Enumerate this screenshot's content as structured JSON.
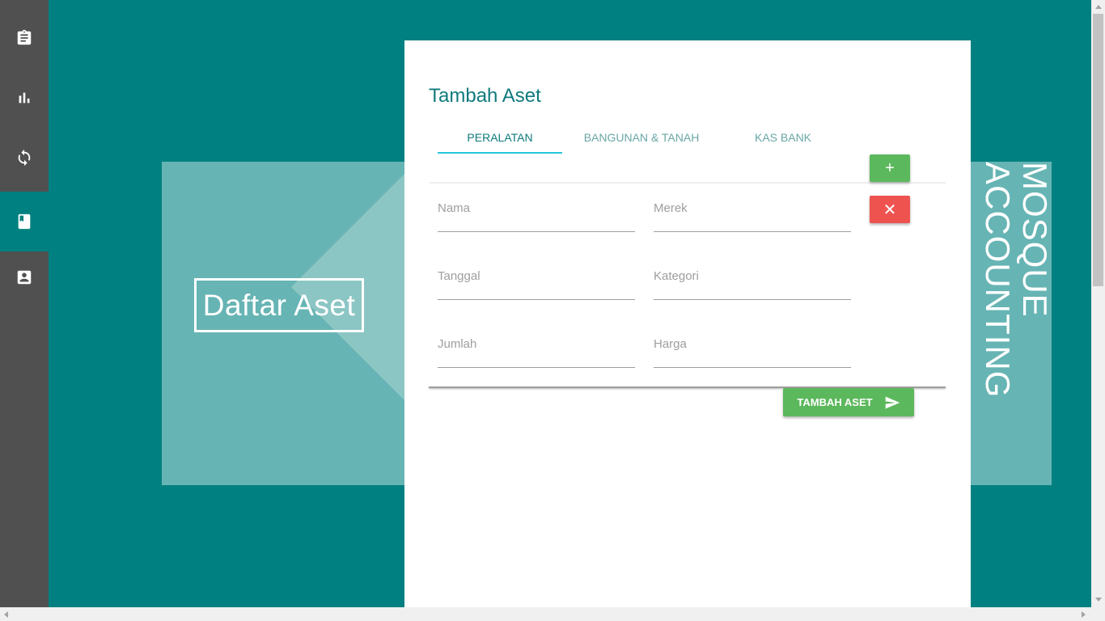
{
  "sidebar": {
    "items": [
      {
        "icon": "clipboard-icon",
        "active": false
      },
      {
        "icon": "bar-chart-icon",
        "active": false
      },
      {
        "icon": "sync-icon",
        "active": false
      },
      {
        "icon": "book-icon",
        "active": true
      },
      {
        "icon": "contact-icon",
        "active": false
      }
    ]
  },
  "hero": {
    "title": "Daftar Aset"
  },
  "brand": {
    "line1": "MOSQUE",
    "line2": "ACCOUNTING"
  },
  "card": {
    "title": "Tambah Aset",
    "tabs": [
      {
        "label": "PERALATAN",
        "active": true
      },
      {
        "label": "BANGUNAN & TANAH",
        "active": false
      },
      {
        "label": "KAS BANK",
        "active": false
      }
    ],
    "fields": {
      "nama": {
        "placeholder": "Nama",
        "value": ""
      },
      "merek": {
        "placeholder": "Merek",
        "value": ""
      },
      "tanggal": {
        "placeholder": "Tanggal",
        "value": ""
      },
      "kategori": {
        "placeholder": "Kategori",
        "value": ""
      },
      "jumlah": {
        "placeholder": "Jumlah",
        "value": ""
      },
      "harga": {
        "placeholder": "Harga",
        "value": ""
      }
    },
    "add_label": "+",
    "remove_label": "✕",
    "submit_label": "TAMBAH ASET"
  },
  "colors": {
    "accent": "#008080",
    "sidebar": "#505050",
    "success": "#5cb85c",
    "danger": "#ef5350",
    "tab_indicator": "#26c6da"
  }
}
